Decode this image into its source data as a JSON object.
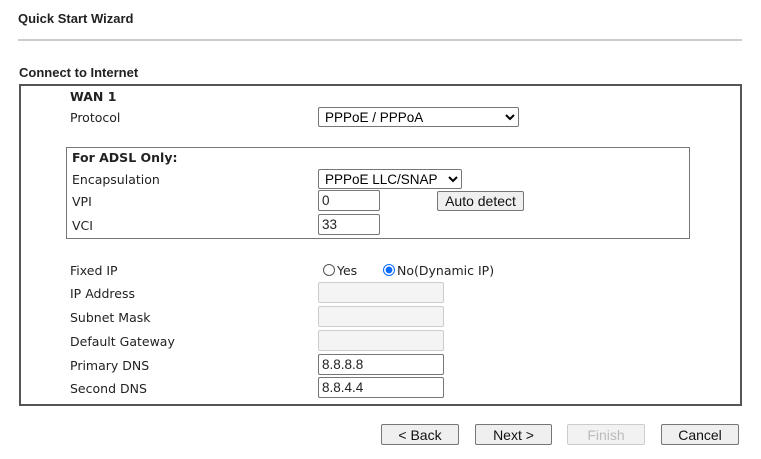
{
  "header": {
    "title": "Quick Start Wizard"
  },
  "section": {
    "title": "Connect to Internet"
  },
  "wan": {
    "title": "WAN 1",
    "protocol_label": "Protocol",
    "protocol_value": "PPPoE / PPPoA",
    "adsl": {
      "title": "For ADSL Only:",
      "encapsulation_label": "Encapsulation",
      "encapsulation_value": "PPPoE LLC/SNAP",
      "vpi_label": "VPI",
      "vpi_value": "0",
      "vci_label": "VCI",
      "vci_value": "33",
      "auto_detect_label": "Auto detect"
    },
    "fixed_ip_label": "Fixed IP",
    "fixed_ip_yes": "Yes",
    "fixed_ip_no": "No(Dynamic IP)",
    "fixed_ip_selected": "no",
    "ip_address_label": "IP Address",
    "ip_address_value": "",
    "subnet_mask_label": "Subnet Mask",
    "subnet_mask_value": "",
    "gateway_label": "Default Gateway",
    "gateway_value": "",
    "primary_dns_label": "Primary DNS",
    "primary_dns_value": "8.8.8.8",
    "second_dns_label": "Second DNS",
    "second_dns_value": "8.8.4.4"
  },
  "footer": {
    "back": "< Back",
    "next": "Next >",
    "finish": "Finish",
    "cancel": "Cancel"
  }
}
